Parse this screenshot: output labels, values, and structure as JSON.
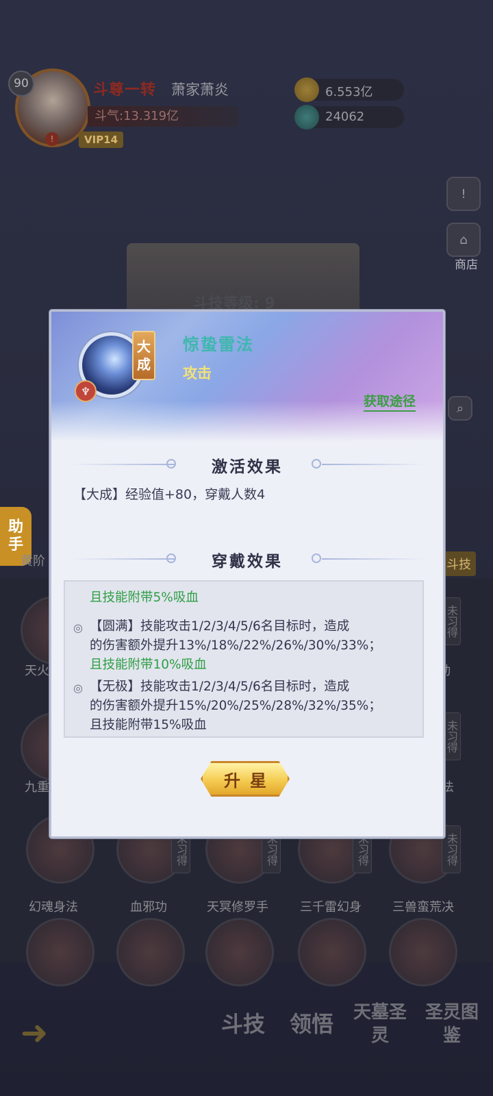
{
  "player": {
    "level": "90",
    "rank": "斗尊一转",
    "name": "萧家萧炎",
    "power": "斗气:13.319亿",
    "vip": "VIP14",
    "alert": "!"
  },
  "resources": {
    "gold": "6.553亿",
    "gem": "24062"
  },
  "side": {
    "info_icon": "!",
    "shop_label": "商店"
  },
  "background": {
    "skill_level_label": "斗技等级: 9",
    "helper_label_1": "助",
    "helper_label_2": "手",
    "tab_left": "黄阶",
    "tab_right": "斗技",
    "unget": "未习得",
    "skills_row3": [
      "幻魂身法",
      "血邪功",
      "天冥修罗手",
      "三千雷幻身",
      "三兽蛮荒决"
    ],
    "skills_left_partial": [
      "天火",
      "九重"
    ],
    "skills_right_partial": [
      "动",
      "法"
    ]
  },
  "bottom_nav": {
    "item1": "斗技",
    "item2": "领悟",
    "item3": "天墓圣灵",
    "item4": "圣灵图鉴",
    "alert": "!"
  },
  "modal": {
    "skill_name": "惊蛰雷法",
    "skill_type": "攻击",
    "tier_1": "大",
    "tier_2": "成",
    "obtain_link": "获取途径",
    "activate_title": "激活效果",
    "activate_text": "【大成】经验值+80，穿戴人数4",
    "wear_title": "穿戴效果",
    "wear_lines": [
      "且技能附带5%吸血",
      "【圆满】技能攻击1/2/3/4/5/6名目标时，造成",
      "的伤害额外提升13%/18%/22%/26%/30%/33%；",
      "且技能附带10%吸血",
      "【无极】技能攻击1/2/3/4/5/6名目标时，造成",
      "的伤害额外提升15%/20%/25%/28%/32%/35%；",
      "且技能附带15%吸血"
    ],
    "upgrade_button": "升星"
  }
}
